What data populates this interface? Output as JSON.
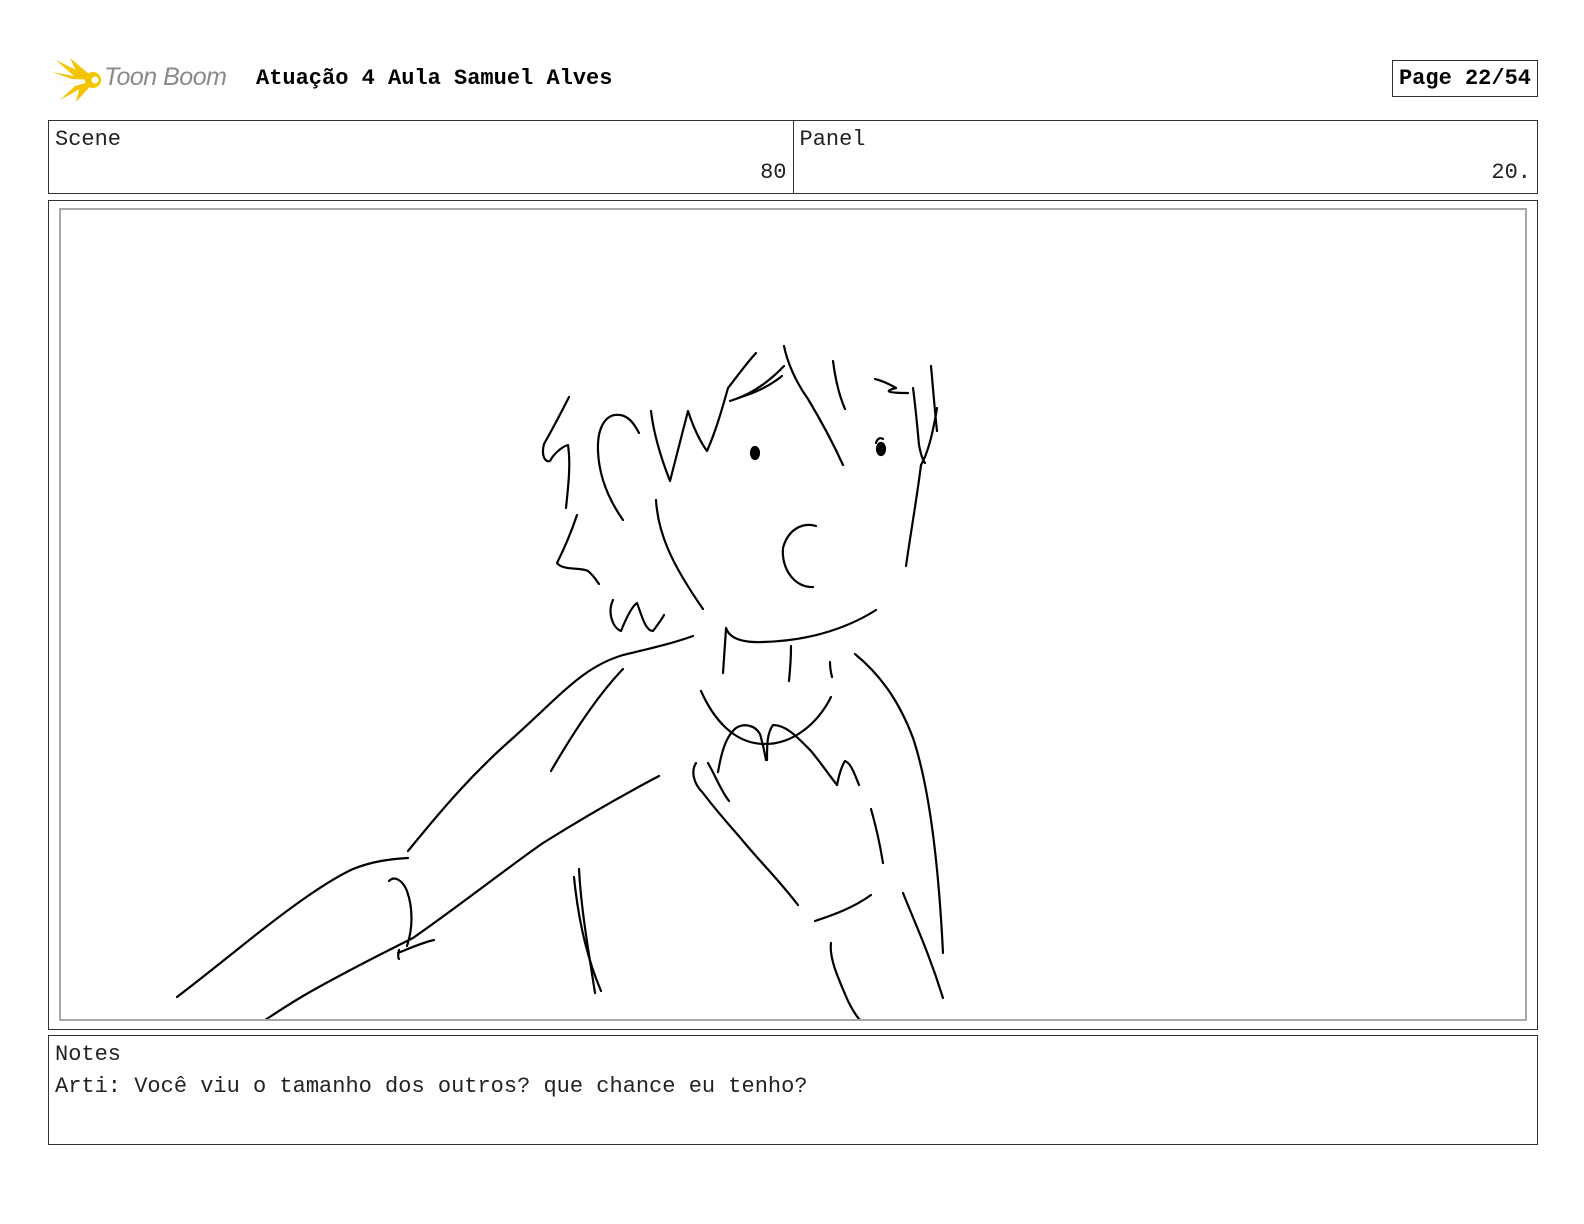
{
  "header": {
    "logo_text": "Toon Boom",
    "title": "Atuação 4 Aula Samuel Alves",
    "page": "Page 22/54"
  },
  "meta": {
    "scene_label": "Scene",
    "scene_value": "80",
    "panel_label": "Panel",
    "panel_value": "20."
  },
  "notes": {
    "label": "Notes",
    "text": "Arti: Você viu o tamanho dos outros? que chance eu tenho?"
  }
}
